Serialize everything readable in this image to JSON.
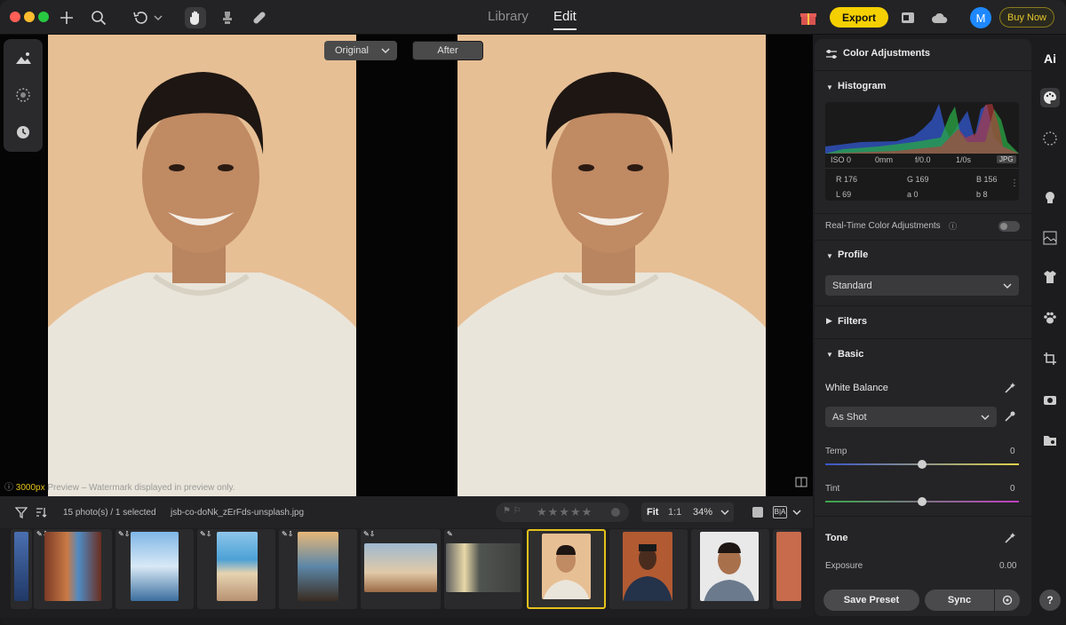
{
  "titlebar": {
    "nav_library": "Library",
    "nav_edit": "Edit",
    "export": "Export",
    "buy_now": "Buy Now",
    "avatar_initial": "M"
  },
  "canvas": {
    "original_label": "Original",
    "after_label": "After",
    "preview_size": "3000px",
    "watermark": "Preview – Watermark displayed in preview only."
  },
  "filmstrip": {
    "count_text": "15 photo(s) / 1 selected",
    "filename": "jsb-co-doNk_zErFds-unsplash.jpg",
    "zoom_fit": "Fit",
    "zoom_1to1": "1:1",
    "zoom_level": "34%",
    "stars": "★★★★★"
  },
  "panel": {
    "title": "Color Adjustments",
    "histogram": {
      "title": "Histogram",
      "iso": "ISO 0",
      "focal": "0mm",
      "aperture": "f/0.0",
      "shutter": "1/0s",
      "format": "JPG",
      "r": "R 176",
      "g": "G 169",
      "b": "B 156",
      "l": "L 69",
      "a": "a 0",
      "b2": "b 8"
    },
    "realtime_label": "Real-Time Color Adjustments",
    "profile": {
      "title": "Profile",
      "value": "Standard"
    },
    "filters_title": "Filters",
    "basic": {
      "title": "Basic",
      "wb_label": "White Balance",
      "wb_value": "As Shot",
      "temp_label": "Temp",
      "temp_value": "0",
      "temp_pos": 0.5,
      "tint_label": "Tint",
      "tint_value": "0",
      "tint_pos": 0.5
    },
    "tone": {
      "title": "Tone",
      "exposure_label": "Exposure",
      "exposure_value": "0.00"
    },
    "save_preset": "Save Preset",
    "sync": "Sync"
  },
  "sidebar": {
    "ai_label": "Ai"
  },
  "colors": {
    "accent_yellow": "#f5d000",
    "photo_bg": "#e7bf95"
  }
}
